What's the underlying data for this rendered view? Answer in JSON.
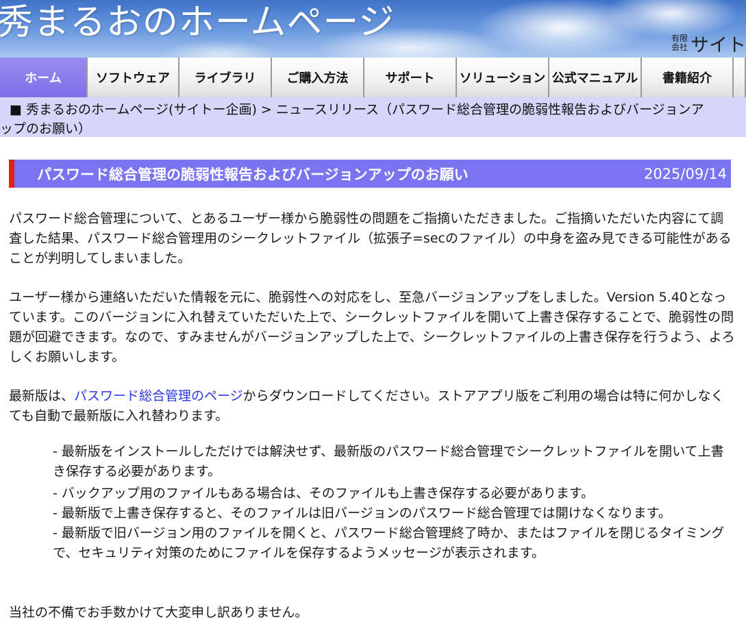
{
  "header": {
    "site_title": "秀まるおのホームページ",
    "company_prefix_top": "有限",
    "company_prefix_bottom": "会社",
    "company_name": "サイト"
  },
  "nav": {
    "items": [
      {
        "label": "ホーム"
      },
      {
        "label": "ソフトウェア"
      },
      {
        "label": "ライブラリ"
      },
      {
        "label": "ご購入方法"
      },
      {
        "label": "サポート"
      },
      {
        "label": "ソリューション"
      },
      {
        "label": "公式マニュアル"
      },
      {
        "label": "書籍紹介"
      }
    ]
  },
  "breadcrumb": {
    "bullet": "■",
    "home_link": "秀まるおのホームページ(サイトー企画)",
    "separator": " > ",
    "line1_rest": "ニュースリリース（パスワード総合管理の脆弱性報告およびバージョンア",
    "line2": "ップのお願い）"
  },
  "article": {
    "title": "パスワード総合管理の脆弱性報告およびバージョンアップのお願い",
    "date": "2025/09/14",
    "paragraph1": "パスワード総合管理について、とあるユーザー様から脆弱性の問題をご指摘いただきました。ご指摘いただいた内容にて調査した結果、パスワード総合管理用のシークレットファイル（拡張子=secのファイル）の中身を盗み見できる可能性があることが判明してしまいました。",
    "paragraph2": "ユーザー様から連絡いただいた情報を元に、脆弱性への対応をし、至急バージョンアップをしました。Version 5.40となっています。このバージョンに入れ替えていただいた上で、シークレットファイルを開いて上書き保存することで、脆弱性の問題が回避できます。なので、すみませんがバージョンアップした上で、シークレットファイルの上書き保存を行うよう、よろしくお願いします。",
    "paragraph3_before": "最新版は、",
    "paragraph3_link": "パスワード総合管理のページ",
    "paragraph3_after": "からダウンロードしてください。ストアアプリ版をご利用の場合は特に何かしなくても自動で最新版に入れ替わります。",
    "notes": [
      "- 最新版をインストールしただけでは解決せず、最新版のパスワード総合管理でシークレットファイルを開いて上書き保存する必要があります。",
      "- バックアップ用のファイルもある場合は、そのファイルも上書き保存する必要があります。",
      "- 最新版で上書き保存すると、そのファイルは旧バージョンのパスワード総合管理では開けなくなります。",
      "- 最新版で旧バージョン用のファイルを開くと、パスワード総合管理終了時か、またはファイルを閉じるタイミングで、セキュリティ対策のためにファイルを保存するようメッセージが表示されます。"
    ],
    "closing": "当社の不備でお手数かけて大変申し訳ありません。"
  },
  "colors": {
    "nav_active": "#7f6ee8",
    "breadcrumb_bg": "#d6d6fb",
    "article_bar": "#7b74f0",
    "article_bar_accent": "#e0201c",
    "link": "#2a38e6"
  }
}
